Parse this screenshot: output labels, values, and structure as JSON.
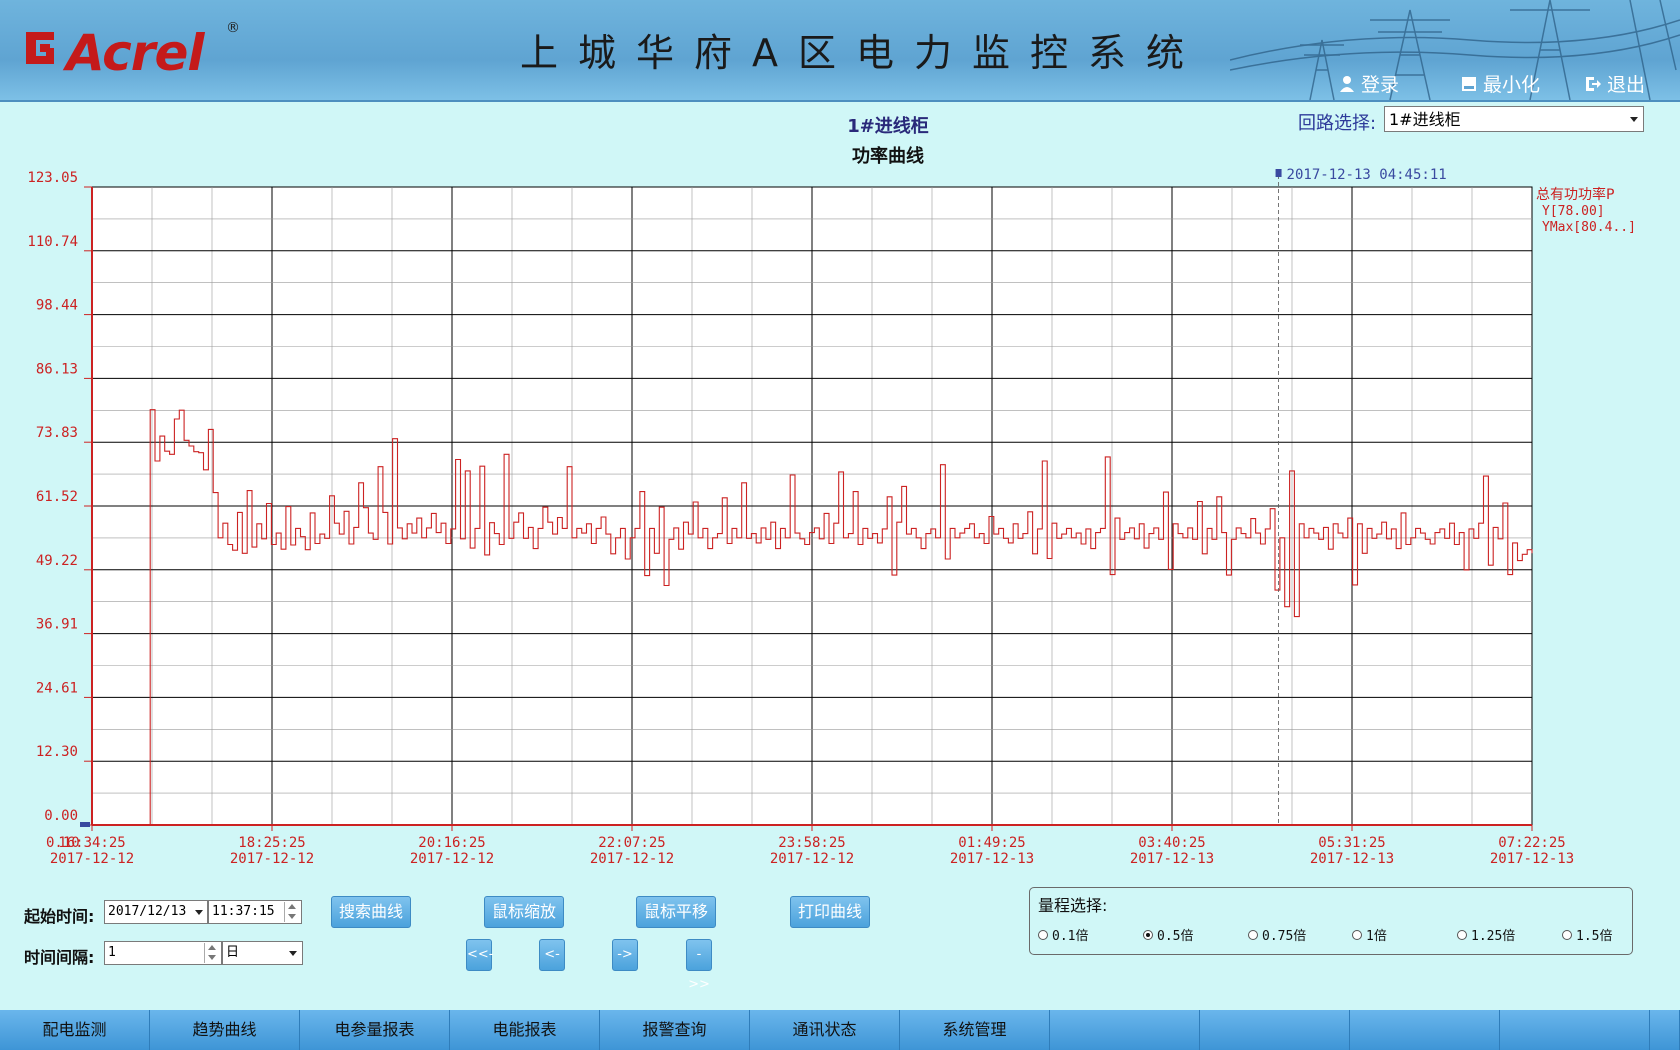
{
  "header": {
    "logo_text": "Acrel",
    "logo_reg": "®",
    "system_title": "上城华府A区电力监控系统",
    "buttons": {
      "login": "登录",
      "minimize": "最小化",
      "exit": "退出"
    }
  },
  "main": {
    "circuit_title": "1#进线柜",
    "chart_title": "功率曲线",
    "loop_select_label": "回路选择:",
    "loop_select_value": "1#进线柜"
  },
  "chart_data": {
    "type": "line",
    "title": "功率曲线",
    "ylim": [
      0.0,
      123.05
    ],
    "y_ticks": [
      "0.00",
      "12.30",
      "24.61",
      "36.91",
      "49.22",
      "61.52",
      "73.83",
      "86.13",
      "98.44",
      "110.74",
      "123.05"
    ],
    "x_ticks": [
      {
        "time": "16:34:25",
        "date": "2017-12-12"
      },
      {
        "time": "18:25:25",
        "date": "2017-12-12"
      },
      {
        "time": "20:16:25",
        "date": "2017-12-12"
      },
      {
        "time": "22:07:25",
        "date": "2017-12-12"
      },
      {
        "time": "23:58:25",
        "date": "2017-12-12"
      },
      {
        "time": "01:49:25",
        "date": "2017-12-13"
      },
      {
        "time": "03:40:25",
        "date": "2017-12-13"
      },
      {
        "time": "05:31:25",
        "date": "2017-12-13"
      },
      {
        "time": "07:22:25",
        "date": "2017-12-13"
      }
    ],
    "y_axis_start_label": "0.10",
    "cursor_label": "2017-12-13 04:45:11",
    "legend": {
      "series_name": "总有功功率P",
      "y_value": "Y[78.00]",
      "ymax_value": "YMax[80.4..]"
    },
    "series": [
      {
        "name": "总有功功率P",
        "color": "#cc2222",
        "values": [
          0.1,
          0.1,
          0.1,
          0.1,
          0.1,
          0.1,
          0.1,
          0.1,
          0.1,
          0.1,
          0.1,
          0.1,
          80.1,
          70.2,
          75.0,
          72.1,
          71.5,
          78.3,
          80.0,
          74.2,
          73.1,
          72.0,
          71.8,
          68.5,
          76.3,
          64.1,
          55.4,
          58.2,
          54.1,
          53.0,
          60.3,
          52.4,
          64.5,
          53.6,
          58.1,
          55.2,
          62.0,
          54.1,
          56.3,
          53.2,
          61.4,
          54.0,
          57.2,
          55.6,
          53.1,
          60.2,
          54.3,
          56.1,
          55.3,
          63.5,
          58.2,
          56.1,
          60.5,
          54.2,
          57.4,
          66.0,
          61.2,
          56.3,
          55.1,
          69.1,
          60.3,
          54.2,
          74.5,
          57.3,
          55.2,
          58.1,
          56.3,
          59.2,
          55.4,
          57.3,
          60.1,
          56.4,
          58.2,
          54.3,
          57.1,
          70.5,
          55.2,
          68.3,
          53.4,
          57.2,
          69.2,
          52.1,
          58.3,
          56.2,
          54.1,
          71.5,
          55.3,
          58.4,
          60.2,
          55.3,
          57.4,
          53.3,
          57.2,
          61.3,
          58.4,
          56.1,
          59.3,
          57.2,
          69.1,
          55.4,
          57.2,
          56.3,
          58.1,
          54.3,
          57.2,
          59.4,
          56.1,
          52.3,
          55.4,
          57.2,
          51.3,
          55.4,
          57.2,
          64.3,
          48.1,
          57.2,
          52.4,
          61.3,
          46.2,
          55.1,
          57.3,
          53.2,
          58.4,
          56.1,
          62.3,
          55.4,
          57.2,
          53.3,
          55.4,
          56.2,
          63.1,
          54.3,
          57.2,
          55.4,
          66.0,
          55.3,
          56.2,
          54.4,
          57.3,
          55.1,
          58.4,
          53.3,
          57.2,
          55.4,
          67.5,
          56.3,
          55.2,
          54.1,
          56.4,
          57.3,
          55.2,
          60.1,
          54.3,
          58.2,
          68.1,
          55.4,
          56.2,
          64.3,
          54.1,
          57.2,
          55.3,
          56.2,
          54.4,
          57.1,
          63.3,
          48.2,
          58.4,
          65.3,
          56.1,
          57.2,
          55.4,
          53.3,
          56.2,
          57.1,
          55.4,
          69.5,
          51.3,
          57.2,
          55.4,
          56.3,
          57.2,
          58.1,
          55.4,
          56.2,
          54.3,
          59.5,
          56.1,
          57.2,
          55.3,
          54.4,
          58.1,
          55.3,
          56.2,
          60.4,
          52.3,
          57.1,
          70.2,
          51.4,
          58.2,
          55.3,
          56.1,
          57.2,
          55.4,
          56.3,
          54.2,
          57.1,
          53.3,
          56.4,
          57.2,
          71.0,
          48.3,
          59.2,
          55.1,
          56.4,
          57.3,
          55.2,
          58.1,
          53.4,
          56.2,
          57.3,
          55.1,
          64.2,
          49.3,
          58.1,
          56.2,
          55.4,
          57.3,
          55.1,
          62.4,
          52.3,
          57.2,
          55.1,
          63.3,
          56.4,
          48.2,
          55.1,
          57.3,
          56.2,
          55.4,
          59.1,
          56.3,
          54.2,
          57.1,
          61.0,
          45.3,
          55.4,
          42.1,
          68.3,
          40.2,
          58.1,
          55.4,
          57.2,
          56.3,
          55.1,
          57.4,
          53.2,
          58.1,
          56.3,
          55.4,
          59.2,
          46.3,
          58.1,
          52.4,
          57.2,
          55.3,
          56.1,
          58.4,
          55.2,
          57.1,
          53.3,
          60.2,
          54.1,
          55.4,
          57.2,
          56.3,
          55.1,
          54.2,
          56.4,
          57.1,
          55.3,
          58.2,
          54.1,
          56.4,
          49.2,
          57.1,
          55.3,
          58.2,
          67.3,
          50.1,
          57.4,
          55.2,
          62.1,
          48.3,
          54.4,
          51.0,
          52.2,
          53.1,
          52.4
        ]
      }
    ]
  },
  "controls": {
    "start_time_label": "起始时间:",
    "start_date_value": "2017/12/13",
    "start_time_value": "11:37:15",
    "search_button": "搜索曲线",
    "zoom_button": "鼠标缩放",
    "pan_button": "鼠标平移",
    "print_button": "打印曲线",
    "interval_label": "时间间隔:",
    "interval_value": "1",
    "interval_unit": "日",
    "nav": {
      "first": "<<-",
      "prev": "<-",
      "next": "->",
      "last": "->>"
    },
    "range": {
      "legend": "量程选择:",
      "options": [
        "0.1倍",
        "0.5倍",
        "0.75倍",
        "1倍",
        "1.25倍",
        "1.5倍"
      ],
      "selected": "0.5倍"
    }
  },
  "bottom_nav": {
    "tabs": [
      "配电监测",
      "趋势曲线",
      "电参量报表",
      "电能报表",
      "报警查询",
      "通讯状态",
      "系统管理",
      "",
      "",
      "",
      "",
      ""
    ]
  }
}
